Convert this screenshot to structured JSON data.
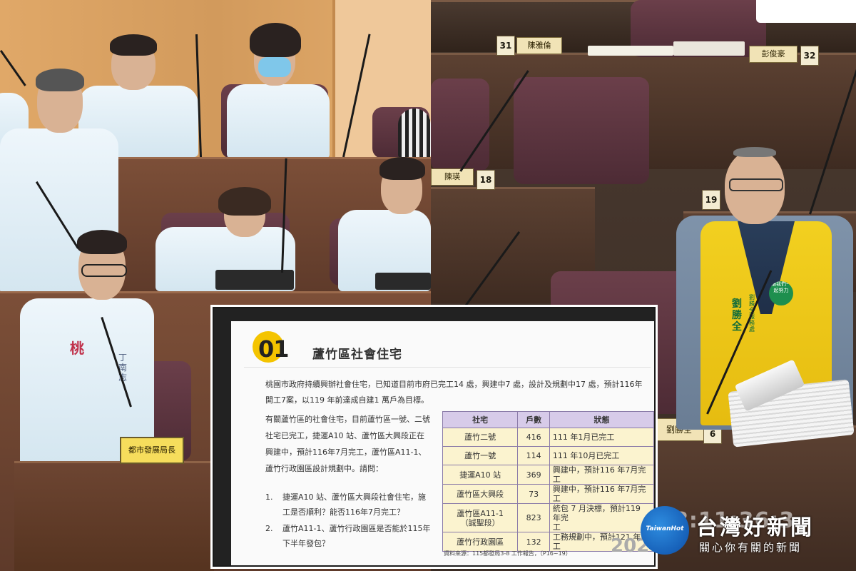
{
  "left_scene": {
    "shirt_logo": "桃",
    "shirt_name": "丁南志",
    "nameplate_label": "都市發展局長"
  },
  "right_scene": {
    "nameplates": [
      {
        "seat_no": "31",
        "name": "陳雅倫"
      },
      {
        "seat_no": "32",
        "name": "彭俊豪"
      },
      {
        "seat_no": "18",
        "name": "陳瑛"
      },
      {
        "seat_no": "19",
        "name": ""
      },
      {
        "seat_no": "6",
        "name": "劉勝全"
      }
    ],
    "vest_name": "劉勝全",
    "vest_badge": "讓我們一起努力",
    "vest_side_text": "劉勝全服務處"
  },
  "slide": {
    "section_number": "01",
    "title": "蘆竹區社會住宅",
    "intro": "桃園市政府持續興辦社會住宅，已知道目前市府已完工14 處，興建中7 處，設計及規劃中17 處，預計116年開工7案，以119 年前達成自建1 萬戶為目標。",
    "question_intro": "有關蘆竹區的社會住宅，目前蘆竹區一號、二號社宅已完工，捷運A10 站、蘆竹區大興段正在興建中，預計116年7月完工，蘆竹區A11-1、蘆竹行政園區設計規劃中。請問：",
    "questions": [
      {
        "num": "1.",
        "text_line1": "捷運A10 站、蘆竹區大興段社會住宅，施",
        "text_line2": "工是否順利？能否116年7月完工？"
      },
      {
        "num": "2.",
        "text_line1": "蘆竹A11-1、蘆竹行政園區是否能於115年",
        "text_line2": "下半年發包？"
      }
    ],
    "table": {
      "headers": [
        "社宅",
        "戶數",
        "狀態"
      ],
      "rows": [
        {
          "name": "蘆竹二號",
          "name2": "",
          "units": "416",
          "status": "111 年1月已完工",
          "status2": ""
        },
        {
          "name": "蘆竹一號",
          "name2": "",
          "units": "114",
          "status": "111 年10月已完工",
          "status2": ""
        },
        {
          "name": "捷運A10 站",
          "name2": "",
          "units": "369",
          "status": "興建中，預計116 年7月完工",
          "status2": ""
        },
        {
          "name": "蘆竹區大興段",
          "name2": "",
          "units": "73",
          "status": "興建中，預計116 年7月完工",
          "status2": ""
        },
        {
          "name": "蘆竹區A11-1",
          "name2": "（誠聖段）",
          "units": "823",
          "status": "統包 7 月決標，預計119 年完",
          "status2": "工"
        },
        {
          "name": "蘆竹行政園區",
          "name2": "",
          "units": "132",
          "status": "工務規劃中，預計121 年完工",
          "status2": ""
        }
      ]
    },
    "source": "資料來源：115都發局3-8 工作報告，（P16~19）",
    "year_fragment": "202"
  },
  "logo": {
    "emblem_text": "TaiwanHot",
    "name": "台灣好新聞",
    "slogan": "關心你有關的新聞"
  },
  "timestamp_fragment": "8:11:36:3",
  "colors": {
    "accent_yellow": "#f4c400",
    "table_header": "#d7cbe9",
    "table_cell": "#fbf3cf",
    "logo_blue": "#1565c0",
    "vest_yellow": "#f2d020"
  }
}
